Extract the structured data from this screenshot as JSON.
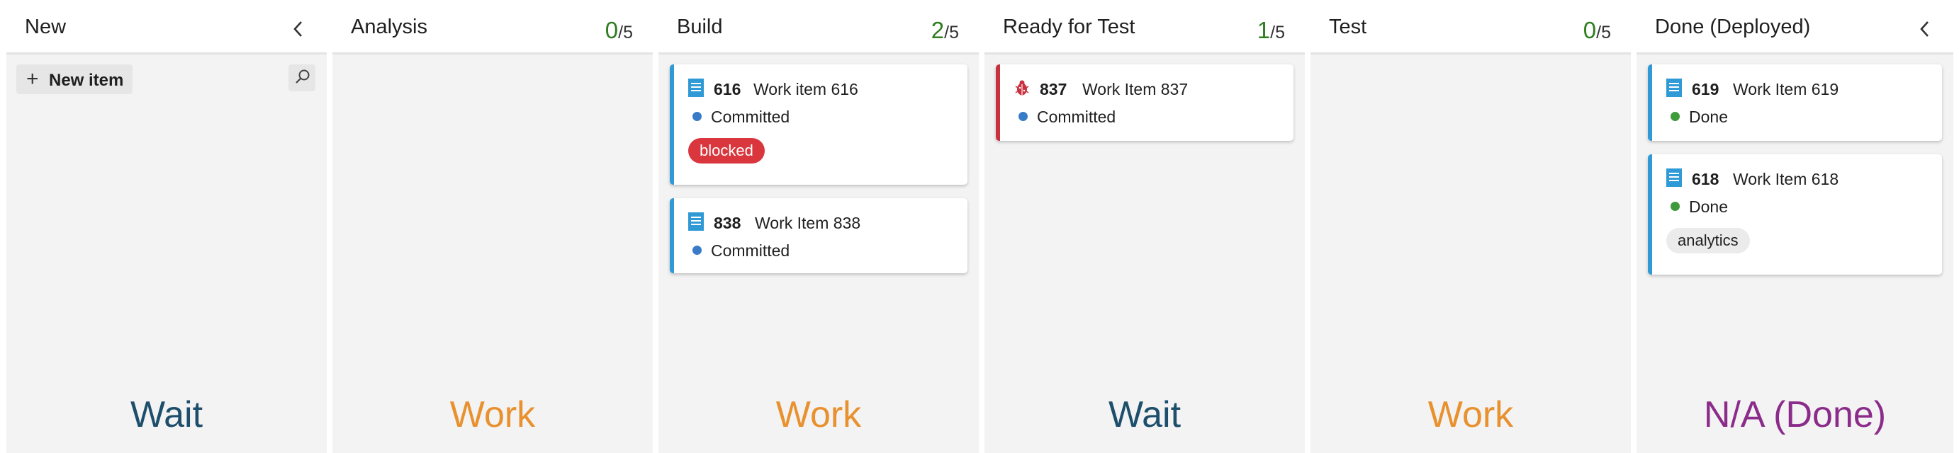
{
  "colors": {
    "committed": "#3a7bc8",
    "done": "#3e9a3a",
    "count_green": "#2f7d1f",
    "wait": "#1d4e6b",
    "work": "#e8912e",
    "na_done": "#8b2b8a",
    "task_bar": "#2f9ad6",
    "bug_bar": "#c8313e",
    "blocked_tag_bg": "#d9363e",
    "tag_bg": "#ebebeb"
  },
  "columns": [
    {
      "title": "New",
      "footer": "Wait",
      "new_item_label": "New item",
      "collapse_icon": "chevron-left-icon",
      "search_icon": "search-icon"
    },
    {
      "title": "Analysis",
      "count": "0",
      "limit": "/5",
      "footer": "Work"
    },
    {
      "title": "Build",
      "count": "2",
      "limit": "/5",
      "footer": "Work",
      "cards": [
        {
          "id": "616",
          "title": "Work item 616",
          "state": "Committed",
          "tag": "blocked",
          "icon": "task-icon"
        },
        {
          "id": "838",
          "title": "Work Item 838",
          "state": "Committed",
          "icon": "task-icon"
        }
      ]
    },
    {
      "title": "Ready for Test",
      "count": "1",
      "limit": "/5",
      "footer": "Wait",
      "cards": [
        {
          "id": "837",
          "title": "Work Item 837",
          "state": "Committed",
          "icon": "bug-icon"
        }
      ]
    },
    {
      "title": "Test",
      "count": "0",
      "limit": "/5",
      "footer": "Work"
    },
    {
      "title": "Done (Deployed)",
      "footer": "N/A (Done)",
      "collapse_icon": "chevron-left-icon",
      "cards": [
        {
          "id": "619",
          "title": "Work Item 619",
          "state": "Done",
          "icon": "task-icon"
        },
        {
          "id": "618",
          "title": "Work Item 618",
          "state": "Done",
          "tag": "analytics",
          "icon": "task-icon"
        }
      ]
    }
  ]
}
